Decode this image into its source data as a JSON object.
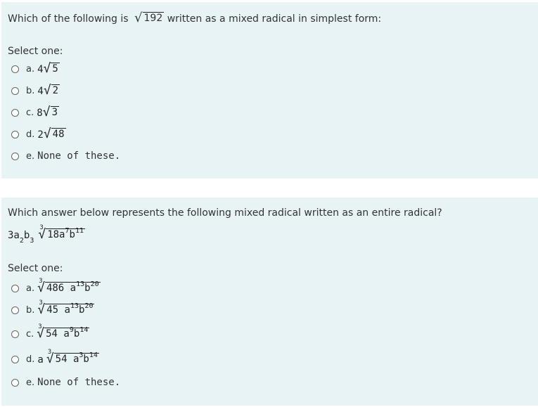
{
  "q1": {
    "prefix": "Which of the following is",
    "radicand": "192",
    "suffix": "written as a mixed radical in simplest form:",
    "select_label": "Select one:",
    "options": [
      {
        "letter": "a.",
        "coef": "4",
        "radicand": "5"
      },
      {
        "letter": "b.",
        "coef": "4",
        "radicand": "2"
      },
      {
        "letter": "c.",
        "coef": "8",
        "radicand": "3"
      },
      {
        "letter": "d.",
        "coef": "2",
        "radicand": "48"
      },
      {
        "letter": "e.",
        "text": "None of these."
      }
    ]
  },
  "q2": {
    "question": "Which answer below represents the following mixed radical written as an entire radical?",
    "expr": {
      "coef": "3a",
      "a_exp": "2",
      "b": "b",
      "b_exp": "3",
      "index": "3",
      "rad_main": "18a",
      "rad_a_exp": "7",
      "rad_b": "b",
      "rad_b_exp": "11"
    },
    "select_label": "Select one:",
    "options": [
      {
        "letter": "a.",
        "index": "3",
        "r1": "486 a",
        "e1": "13",
        "r2": "b",
        "e2": "20"
      },
      {
        "letter": "b.",
        "index": "3",
        "r1": "45 a",
        "e1": "13",
        "r2": "b",
        "e2": "20"
      },
      {
        "letter": "c.",
        "index": "3",
        "r1": "54 a",
        "e1": "9",
        "r2": "b",
        "e2": "14"
      },
      {
        "letter": "d.",
        "coef": "a",
        "index": "3",
        "r1": "54 a",
        "e1": "3",
        "r2": "b",
        "e2": "14"
      },
      {
        "letter": "e.",
        "text": "None of these."
      }
    ]
  }
}
